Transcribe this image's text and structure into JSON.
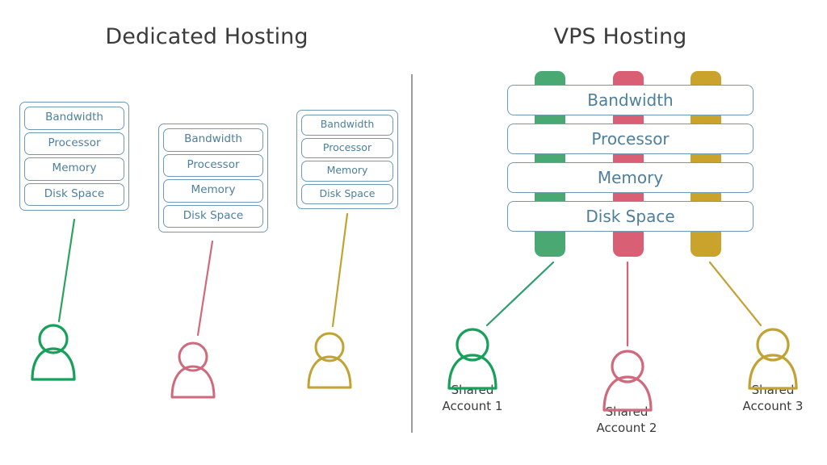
{
  "titles": {
    "dedicated": "Dedicated Hosting",
    "vps": "VPS Hosting"
  },
  "resources": [
    "Bandwidth",
    "Processor",
    "Memory",
    "Disk Space"
  ],
  "dedicated": {
    "servers": [
      {
        "id": "server-1",
        "resources": [
          "Bandwidth",
          "Processor",
          "Memory",
          "Disk Space"
        ],
        "accent": "#2aa35e"
      },
      {
        "id": "server-2",
        "resources": [
          "Bandwidth",
          "Processor",
          "Memory",
          "Disk Space"
        ],
        "accent": "#cf6a7c"
      },
      {
        "id": "server-3",
        "resources": [
          "Bandwidth",
          "Processor",
          "Memory",
          "Disk Space"
        ],
        "accent": "#c2a232"
      }
    ]
  },
  "vps": {
    "rows": [
      "Bandwidth",
      "Processor",
      "Memory",
      "Disk Space"
    ],
    "bars": [
      {
        "color": "#4aa873"
      },
      {
        "color": "#d85f74"
      },
      {
        "color": "#c9a32c"
      }
    ],
    "accounts": [
      {
        "label": "Shared\nAccount 1",
        "color": "#16a05a"
      },
      {
        "label": "Shared\nAccount 2",
        "color": "#cf6a7c"
      },
      {
        "label": "Shared\nAccount 3",
        "color": "#c2a232"
      }
    ]
  },
  "colors": {
    "box_border": "#6f9ab3",
    "box_text": "#4e7f9c",
    "title_text": "#3b3b3b",
    "divider": "#9b9b9b",
    "green": "#4aa873",
    "red": "#d85f74",
    "yellow": "#c9a32c",
    "background": "#ffffff"
  }
}
